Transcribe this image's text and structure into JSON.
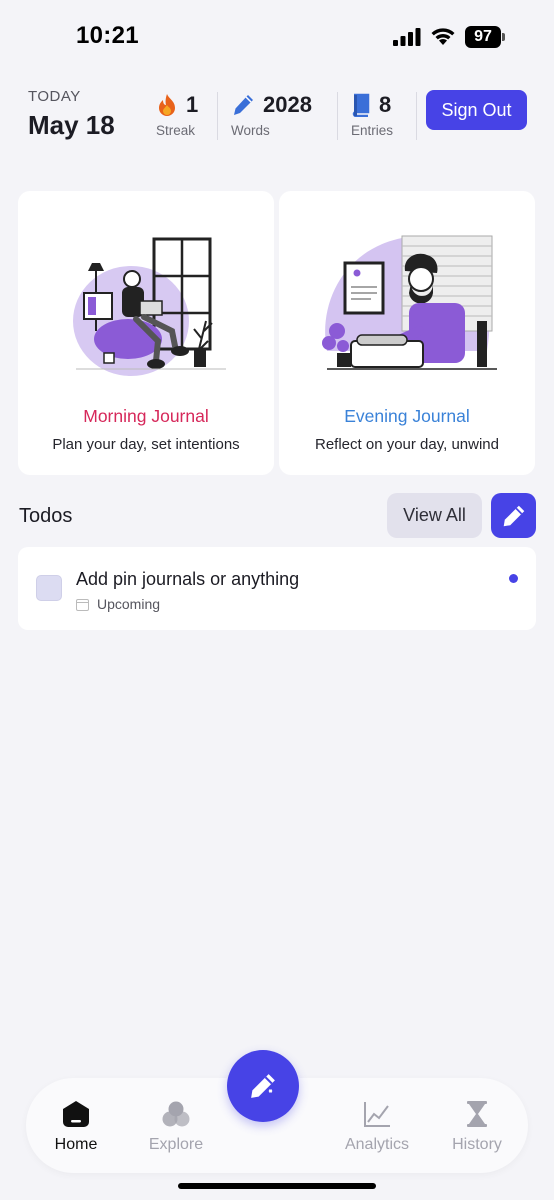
{
  "status": {
    "time": "10:21",
    "battery": "97"
  },
  "header": {
    "today_label": "TODAY",
    "date": "May 18",
    "stats": [
      {
        "value": "1",
        "label": "Streak",
        "icon": "flame-icon"
      },
      {
        "value": "2028",
        "label": "Words",
        "icon": "pen-icon"
      },
      {
        "value": "8",
        "label": "Entries",
        "icon": "book-icon"
      }
    ],
    "sign_out_label": "Sign Out"
  },
  "journals": [
    {
      "title": "Morning Journal",
      "subtitle": "Plan your day, set intentions",
      "color": "#d6285a"
    },
    {
      "title": "Evening Journal",
      "subtitle": "Reflect on your day, unwind",
      "color": "#3a82d8"
    }
  ],
  "todos": {
    "title": "Todos",
    "view_all_label": "View All",
    "items": [
      {
        "text": "Add pin journals or anything",
        "status": "Upcoming"
      }
    ]
  },
  "nav": {
    "items": [
      {
        "label": "Home",
        "icon": "home-icon",
        "active": true
      },
      {
        "label": "Explore",
        "icon": "explore-icon",
        "active": false
      },
      {
        "label": "Analytics",
        "icon": "analytics-icon",
        "active": false
      },
      {
        "label": "History",
        "icon": "hourglass-icon",
        "active": false
      }
    ]
  },
  "colors": {
    "accent": "#4743e6",
    "background": "#f4f4f8",
    "illustration": "#8b5bd6"
  }
}
